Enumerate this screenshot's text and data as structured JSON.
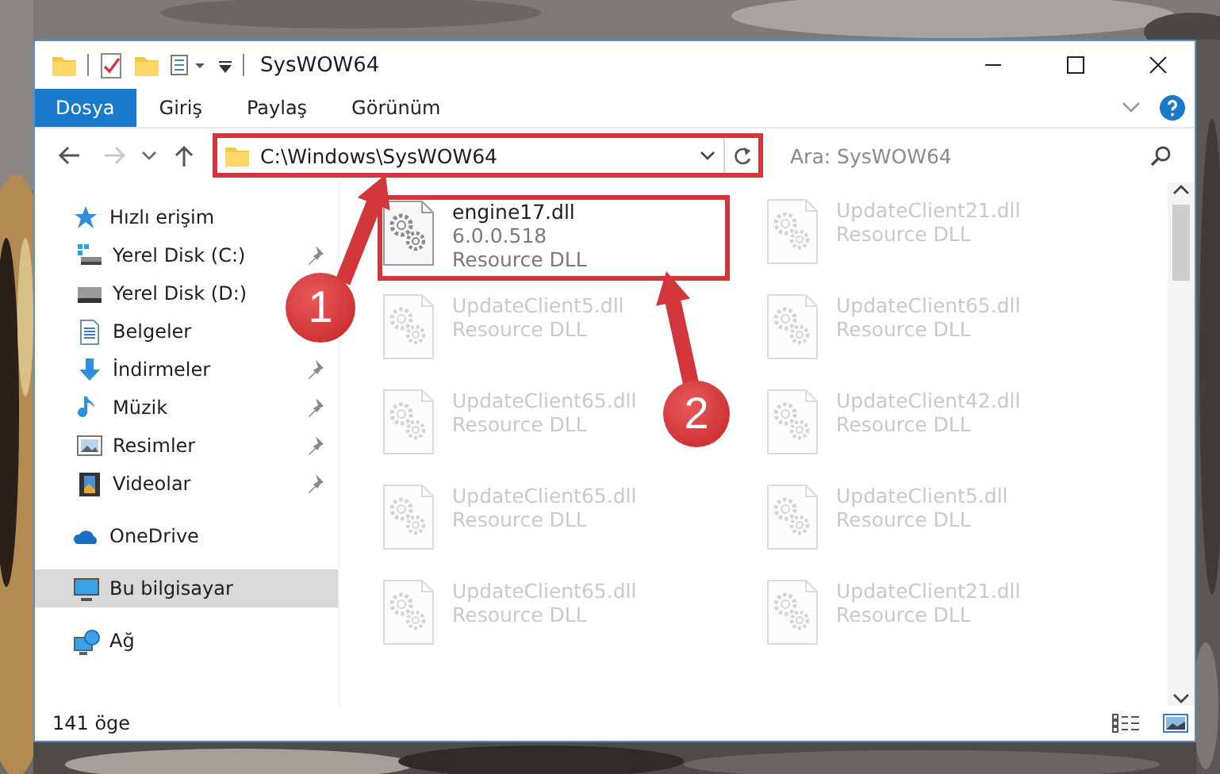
{
  "window": {
    "title": "SysWOW64"
  },
  "ribbon": {
    "tabs": [
      {
        "label": "Dosya",
        "selected": true
      },
      {
        "label": "Giriş",
        "selected": false
      },
      {
        "label": "Paylaş",
        "selected": false
      },
      {
        "label": "Görünüm",
        "selected": false
      }
    ]
  },
  "address": {
    "path": "C:\\Windows\\SysWOW64",
    "highlighted": true
  },
  "search": {
    "placeholder": "Ara: SysWOW64"
  },
  "navigation": [
    {
      "label": "Hızlı erişim",
      "kind": "quick",
      "selected": false,
      "children": [
        {
          "label": "Yerel Disk (C:)",
          "kind": "system-drive",
          "pinned": true,
          "selected": false
        },
        {
          "label": "Yerel Disk (D:)",
          "kind": "drive",
          "pinned": false,
          "selected": false
        },
        {
          "label": "Belgeler",
          "kind": "documents",
          "pinned": false,
          "selected": false
        },
        {
          "label": "İndirmeler",
          "kind": "downloads",
          "pinned": true,
          "selected": false
        },
        {
          "label": "Müzik",
          "kind": "music",
          "pinned": true,
          "selected": false
        },
        {
          "label": "Resimler",
          "kind": "pictures",
          "pinned": true,
          "selected": false
        },
        {
          "label": "Videolar",
          "kind": "videos",
          "pinned": true,
          "selected": false
        }
      ]
    },
    {
      "label": "OneDrive",
      "kind": "cloud",
      "selected": false
    },
    {
      "label": "Bu bilgisayar",
      "kind": "computer",
      "selected": true
    },
    {
      "label": "Ağ",
      "kind": "network",
      "selected": false
    }
  ],
  "files": [
    {
      "name": "engine17.dll",
      "version": "6.0.0.518",
      "type": "Resource DLL",
      "highlighted": true,
      "faded": false
    },
    {
      "name": "UpdateClient21.dll",
      "type": "Resource DLL",
      "highlighted": false,
      "faded": true
    },
    {
      "name": "UpdateClient5.dll",
      "type": "Resource DLL",
      "highlighted": false,
      "faded": true
    },
    {
      "name": "UpdateClient65.dll",
      "type": "Resource DLL",
      "highlighted": false,
      "faded": true
    },
    {
      "name": "UpdateClient65.dll",
      "type": "Resource DLL",
      "highlighted": false,
      "faded": true
    },
    {
      "name": "UpdateClient42.dll",
      "type": "Resource DLL",
      "highlighted": false,
      "faded": true
    },
    {
      "name": "UpdateClient65.dll",
      "type": "Resource DLL",
      "highlighted": false,
      "faded": true
    },
    {
      "name": "UpdateClient5.dll",
      "type": "Resource DLL",
      "highlighted": false,
      "faded": true
    },
    {
      "name": "UpdateClient65.dll",
      "type": "Resource DLL",
      "highlighted": false,
      "faded": true
    },
    {
      "name": "UpdateClient21.dll",
      "type": "Resource DLL",
      "highlighted": false,
      "faded": true
    }
  ],
  "annotations": [
    {
      "number": "1"
    },
    {
      "number": "2"
    }
  ],
  "status_bar": {
    "item_count": "141 öge"
  }
}
